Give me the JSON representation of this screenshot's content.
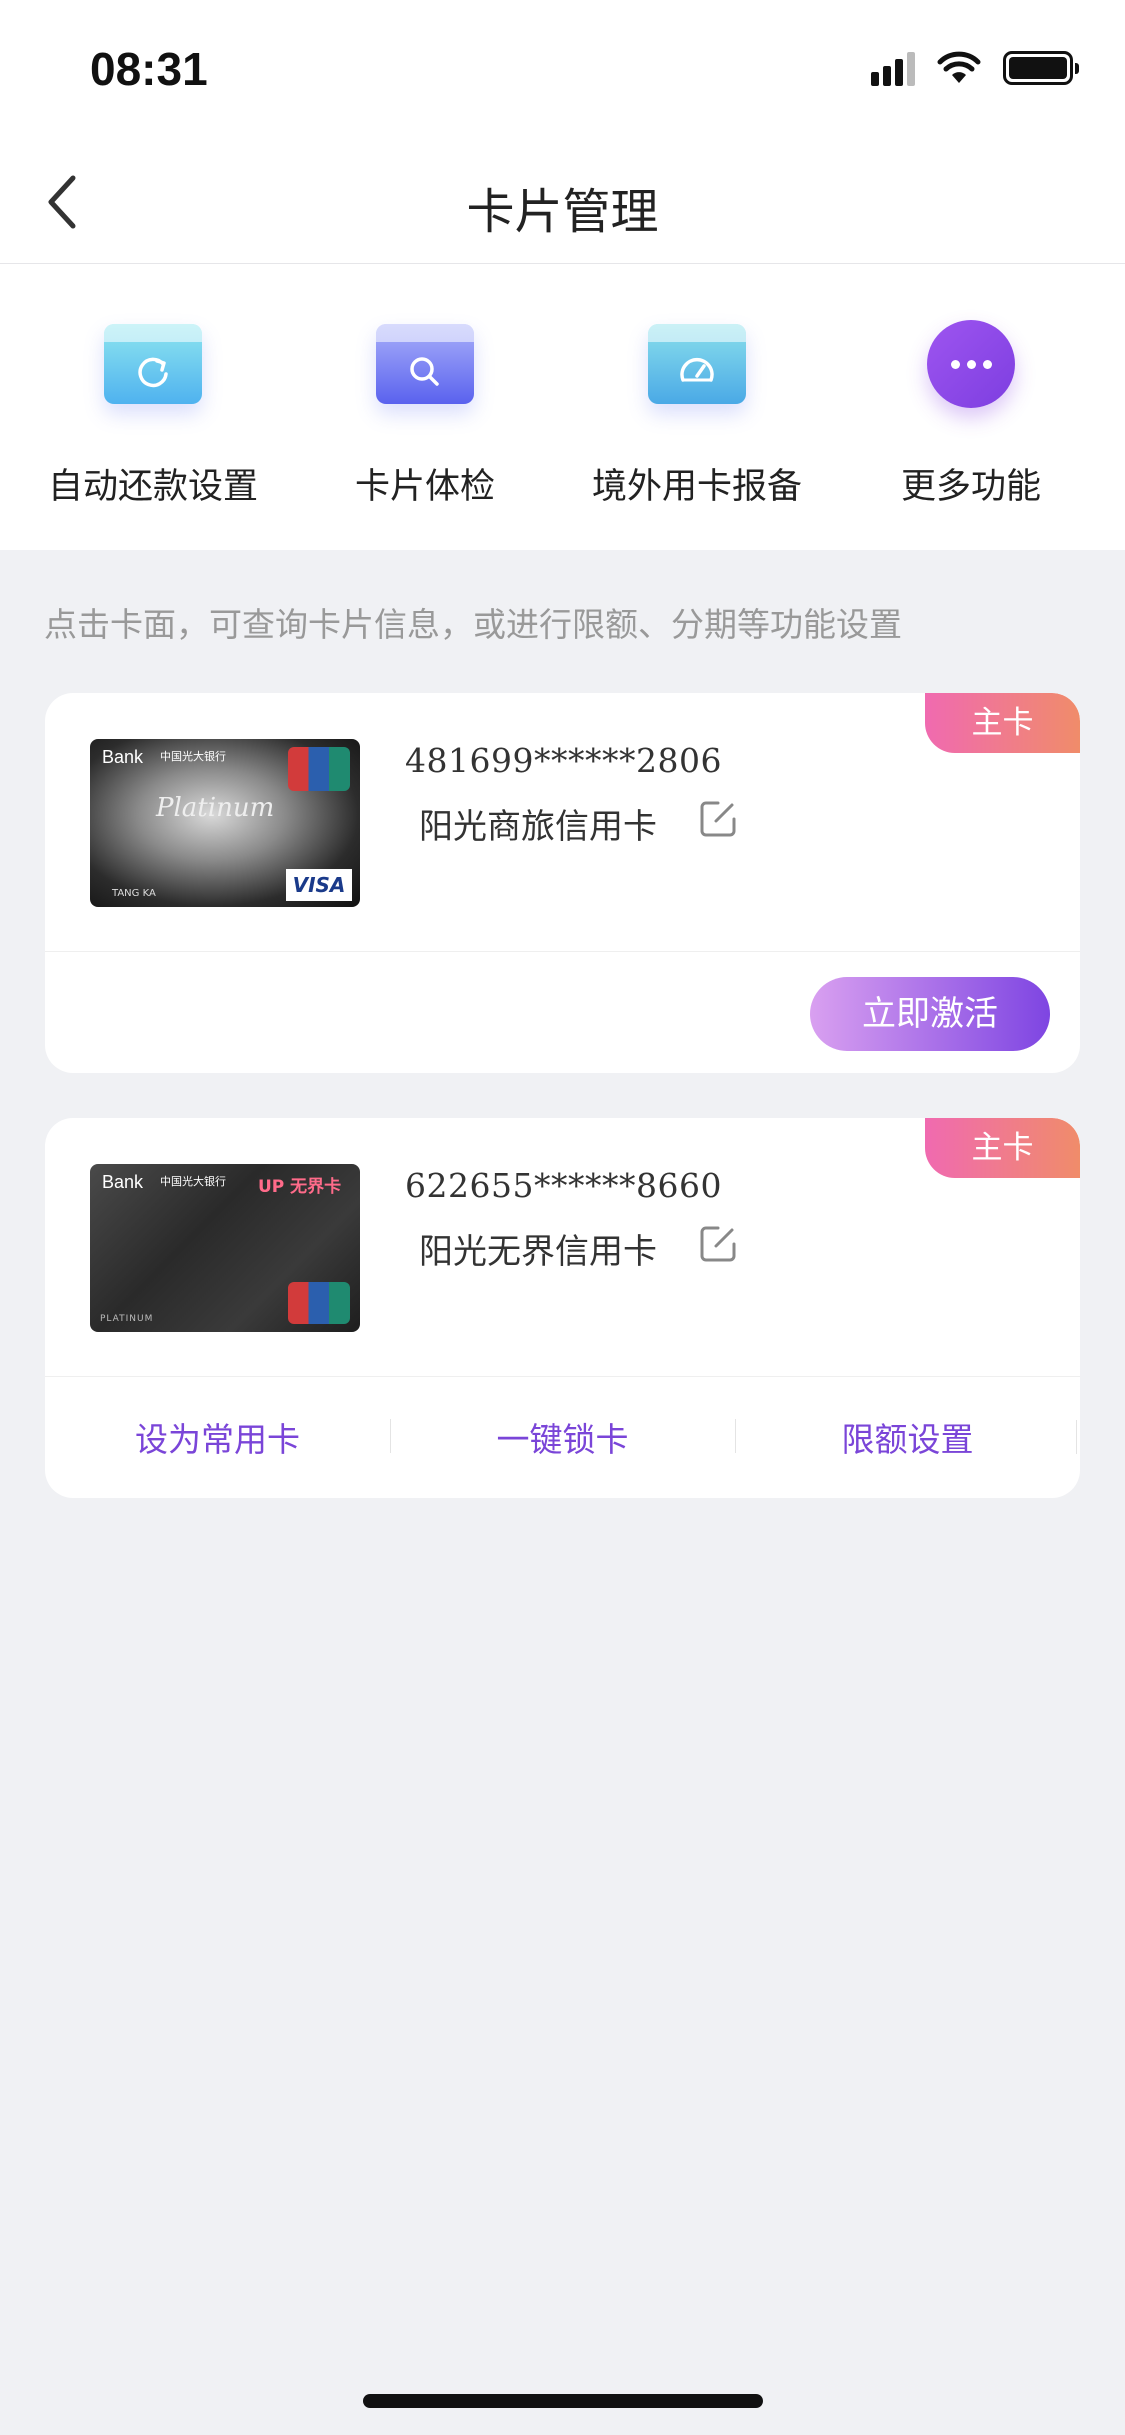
{
  "status_bar": {
    "time": "08:31"
  },
  "nav": {
    "title": "卡片管理"
  },
  "quick_actions": [
    {
      "label": "自动还款设置",
      "icon": "refresh-card-icon",
      "color": "#5fd2e0"
    },
    {
      "label": "卡片体检",
      "icon": "search-card-icon",
      "color": "#6a6ff2"
    },
    {
      "label": "境外用卡报备",
      "icon": "gauge-card-icon",
      "color": "#58c7e0"
    },
    {
      "label": "更多功能",
      "icon": "more-dots-icon",
      "color": "#8e4ce8"
    }
  ],
  "hint": "点击卡面，可查询卡片信息，或进行限额、分期等功能设置",
  "cards": [
    {
      "badge": "主卡",
      "number": "481699******2806",
      "name": "阳光商旅信用卡",
      "image": {
        "bank": "Bank",
        "bank_cn": "中国光大银行",
        "series": "Platinum",
        "network": "VISA",
        "holder": "TANG KA"
      },
      "activate_label": "立即激活"
    },
    {
      "badge": "主卡",
      "number": "622655******8660",
      "name": "阳光无界信用卡",
      "image": {
        "bank": "Bank",
        "bank_cn": "中国光大银行",
        "brand": "UP 无界卡",
        "series": "PLATINUM"
      },
      "actions": [
        "设为常用卡",
        "一键锁卡",
        "限额设置"
      ]
    }
  ],
  "colors": {
    "accent": "#7a45d8",
    "badge_start": "#f06ab0",
    "badge_end": "#f08c6a",
    "background": "#f0f1f4"
  }
}
